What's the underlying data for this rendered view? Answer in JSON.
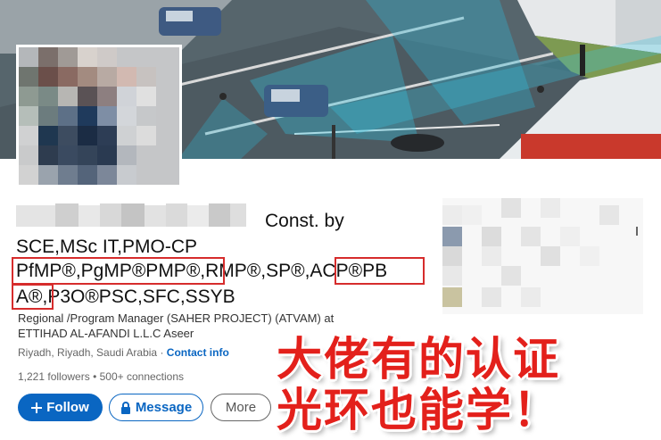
{
  "profile": {
    "headline_suffix": "Const. by",
    "headline_line2": "SCE,MSc IT,PMO-CP",
    "headline_line3": "PfMP®,PgMP®PMP®,RMP®,SP®,ACP®PB",
    "headline_line4": "A®,P3O®PSC,SFC,SSYB",
    "subtitle_line1": "Regional /Program Manager (SAHER PROJECT) (ATVAM) at",
    "subtitle_line2": "ETTIHAD AL-AFANDI L.L.C Aseer",
    "location": "Riyadh, Riyadh, Saudi Arabia",
    "location_separator": "·",
    "contact_info": "Contact info",
    "followers": "1,221 followers",
    "connections_separator": "•",
    "connections": "500+ connections"
  },
  "actions": {
    "follow": "Follow",
    "message": "Message",
    "more": "More"
  },
  "overlay": {
    "caption_line1": "大佬有的认证",
    "caption_line2": "光环也能学！"
  },
  "colors": {
    "accent": "#0a66c2",
    "highlight_box": "#d62c2c",
    "caption": "#e3201b"
  },
  "icons": {
    "follow": "plus-icon",
    "message": "lock-icon"
  }
}
